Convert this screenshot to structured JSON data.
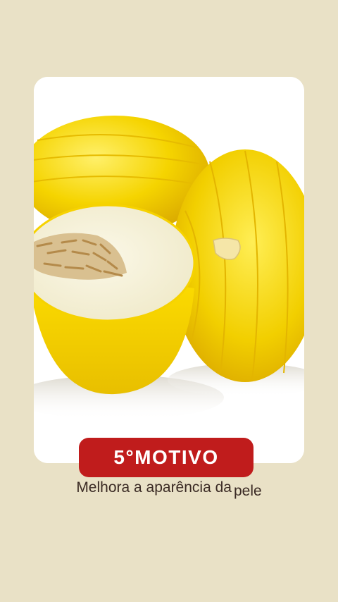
{
  "image": {
    "subject": "melons-photo",
    "colors": {
      "background": "#e9e1c6",
      "rind": "#f2d000",
      "flesh": "#f7f3de",
      "badge": "#c01c1c"
    }
  },
  "badge": {
    "label": "5°MOTIVO"
  },
  "caption": {
    "main": "Melhora a aparência da",
    "tail": "pele"
  }
}
